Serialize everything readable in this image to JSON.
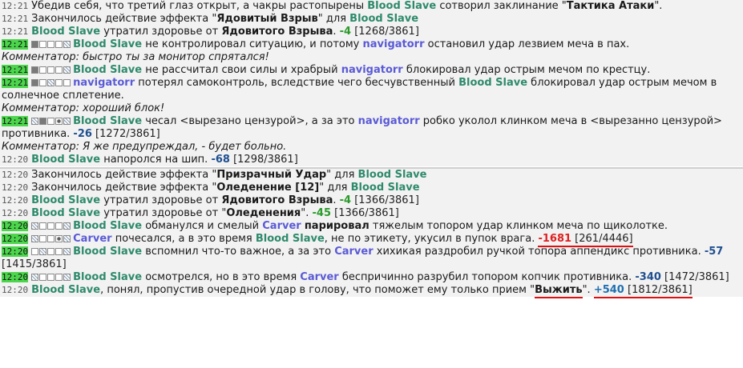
{
  "block1": {
    "l1": {
      "time": "12:21",
      "a": "Убедив себя, что третий глаз открыт, а чакры растопырены ",
      "name": "Blood Slave",
      "b": " сотворил заклинание \"",
      "spell": "Тактика Атаки",
      "c": "\"."
    },
    "l2": {
      "time": "12:21",
      "a": "Закончилось действие эффекта \"",
      "effect": "Ядовитый Взрыв",
      "b": "\" для ",
      "name": "Blood Slave"
    },
    "l3": {
      "time": "12:21",
      "name": "Blood Slave",
      "a": " утратил здоровье от ",
      "source": "Ядовитого Взрыва",
      "b": ". ",
      "amount": "-4",
      "hp": " [1268/3861]"
    },
    "l4": {
      "time": "12:21",
      "n1": "Blood Slave",
      "a": " не контролировал ситуацию, и потому ",
      "n2": "navigatorr",
      "b": " остановил удар лезвием меча в пах."
    },
    "l5": {
      "text": "Комментатор: быстро ты за монитор спрятался!"
    },
    "l6": {
      "time": "12:21",
      "n1": "Blood Slave",
      "a": " не рассчитал свои силы и храбрый ",
      "n2": "navigatorr",
      "b": " блокировал удар острым мечом по крестцу."
    },
    "l7": {
      "time": "12:21",
      "n1": "navigatorr",
      "a": " потерял самоконтроль, вследствие чего бесчувственный ",
      "n2": "Blood Slave",
      "b": " блокировал удар острым мечом в солнечное сплетение."
    },
    "l8": {
      "text": "Комментатор: хороший блок!"
    },
    "l9": {
      "time": "12:21",
      "n1": "Blood Slave",
      "a": " чесал <вырезано цензурой>, а за это ",
      "n2": "navigatorr",
      "b": " робко уколол клинком меча в <вырезанно цензурой> противника. ",
      "amount": "-26",
      "hp": " [1272/3861]"
    },
    "l10": {
      "text": "Комментатор: Я же предупреждал, - будет больно."
    },
    "l11": {
      "time": "12:20",
      "name": "Blood Slave",
      "a": " напоролся на шип. ",
      "amount": "-68",
      "hp": " [1298/3861]"
    }
  },
  "block2": {
    "l1": {
      "time": "12:20",
      "a": "Закончилось действие эффекта \"",
      "effect": "Призрачный Удар",
      "b": "\" для ",
      "name": "Blood Slave"
    },
    "l2": {
      "time": "12:20",
      "a": "Закончилось действие эффекта \"",
      "effect": "Оледенение [12]",
      "b": "\" для ",
      "name": "Blood Slave"
    },
    "l3": {
      "time": "12:20",
      "name": "Blood Slave",
      "a": " утратил здоровье от ",
      "source": "Ядовитого Взрыва",
      "b": ". ",
      "amount": "-4",
      "hp": " [1366/3861]"
    },
    "l4": {
      "time": "12:20",
      "name": "Blood Slave",
      "a": " утратил здоровье от \"",
      "source": "Оледенения",
      "b": "\". ",
      "amount": "-45",
      "hp": " [1366/3861]"
    },
    "l5": {
      "time": "12:20",
      "n1": "Blood Slave",
      "a": " обманулся и смелый ",
      "n2": "Carver",
      "b": " ",
      "bold": "парировал",
      "c": " тяжелым топором удар клинком меча по щиколотке."
    },
    "l6": {
      "time": "12:20",
      "n1": "Carver",
      "a": " почесался, а в это время ",
      "n2": "Blood Slave",
      "b": ", не по этикету, укусил в пупок врага. ",
      "amount": "-1681",
      "hp": " [261/4446]"
    },
    "l7": {
      "time": "12:20",
      "n1": "Blood Slave",
      "a": " вспомнил что-то важное, а за это ",
      "n2": "Carver",
      "b": " хихикая раздробил ручкой топора аппендикс противника. ",
      "amount": "-57",
      "hp": " [1415/3861]"
    },
    "l8": {
      "time": "12:20",
      "n1": "Blood Slave",
      "a": " осмотрелся, но в это время ",
      "n2": "Carver",
      "b": " беспричинно разрубил топором копчик противника. ",
      "amount": "-340",
      "hp": " [1472/3861]"
    },
    "l9": {
      "time": "12:20",
      "name": "Blood Slave",
      "a": ", понял, пропустив очередной удар в голову, что поможет ему только прием \"",
      "skill": "Выжить",
      "b": "\". ",
      "amount": "+540",
      "hp": " [1812/3861]"
    }
  }
}
